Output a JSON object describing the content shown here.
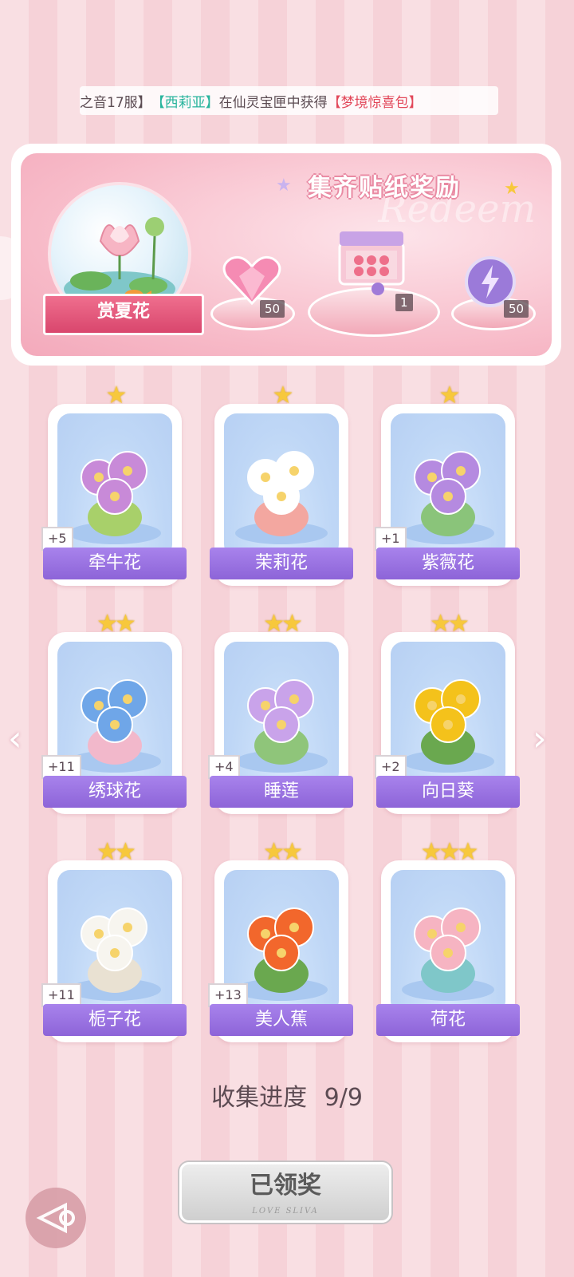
{
  "announcement": {
    "server": "之音17服】",
    "player": "【西莉亚】",
    "middle": "在仙灵宝匣中获得",
    "item": "【梦境惊喜包】"
  },
  "banner": {
    "title": "集齐贴纸奖励",
    "watermark": "Redeem",
    "collection_name": "赏夏花",
    "rewards": [
      {
        "icon": "pink-heart-gem-icon",
        "count": "50"
      },
      {
        "icon": "gift-box-icon",
        "count": "1"
      },
      {
        "icon": "purple-lightning-orb-icon",
        "count": "50"
      }
    ]
  },
  "flowers": [
    {
      "name": "牵牛花",
      "stars": 1,
      "bonus": "+5",
      "icon": "morning-glory-icon"
    },
    {
      "name": "茉莉花",
      "stars": 1,
      "bonus": "",
      "icon": "jasmine-icon"
    },
    {
      "name": "紫薇花",
      "stars": 1,
      "bonus": "+1",
      "icon": "crape-myrtle-icon"
    },
    {
      "name": "绣球花",
      "stars": 2,
      "bonus": "+11",
      "icon": "hydrangea-icon"
    },
    {
      "name": "睡莲",
      "stars": 2,
      "bonus": "+4",
      "icon": "water-lily-icon"
    },
    {
      "name": "向日葵",
      "stars": 2,
      "bonus": "+2",
      "icon": "sunflower-icon"
    },
    {
      "name": "栀子花",
      "stars": 2,
      "bonus": "+11",
      "icon": "gardenia-icon"
    },
    {
      "name": "美人蕉",
      "stars": 2,
      "bonus": "+13",
      "icon": "canna-icon"
    },
    {
      "name": "荷花",
      "stars": 3,
      "bonus": "",
      "icon": "lotus-icon"
    }
  ],
  "progress": {
    "label": "收集进度",
    "value": "9/9"
  },
  "claim_button": {
    "label": "已领奖",
    "sub": "LOVE SLIVA"
  },
  "colors": {
    "accent": "#8d64d8",
    "ribbon": "#e0557a",
    "star": "#f7c83c"
  }
}
